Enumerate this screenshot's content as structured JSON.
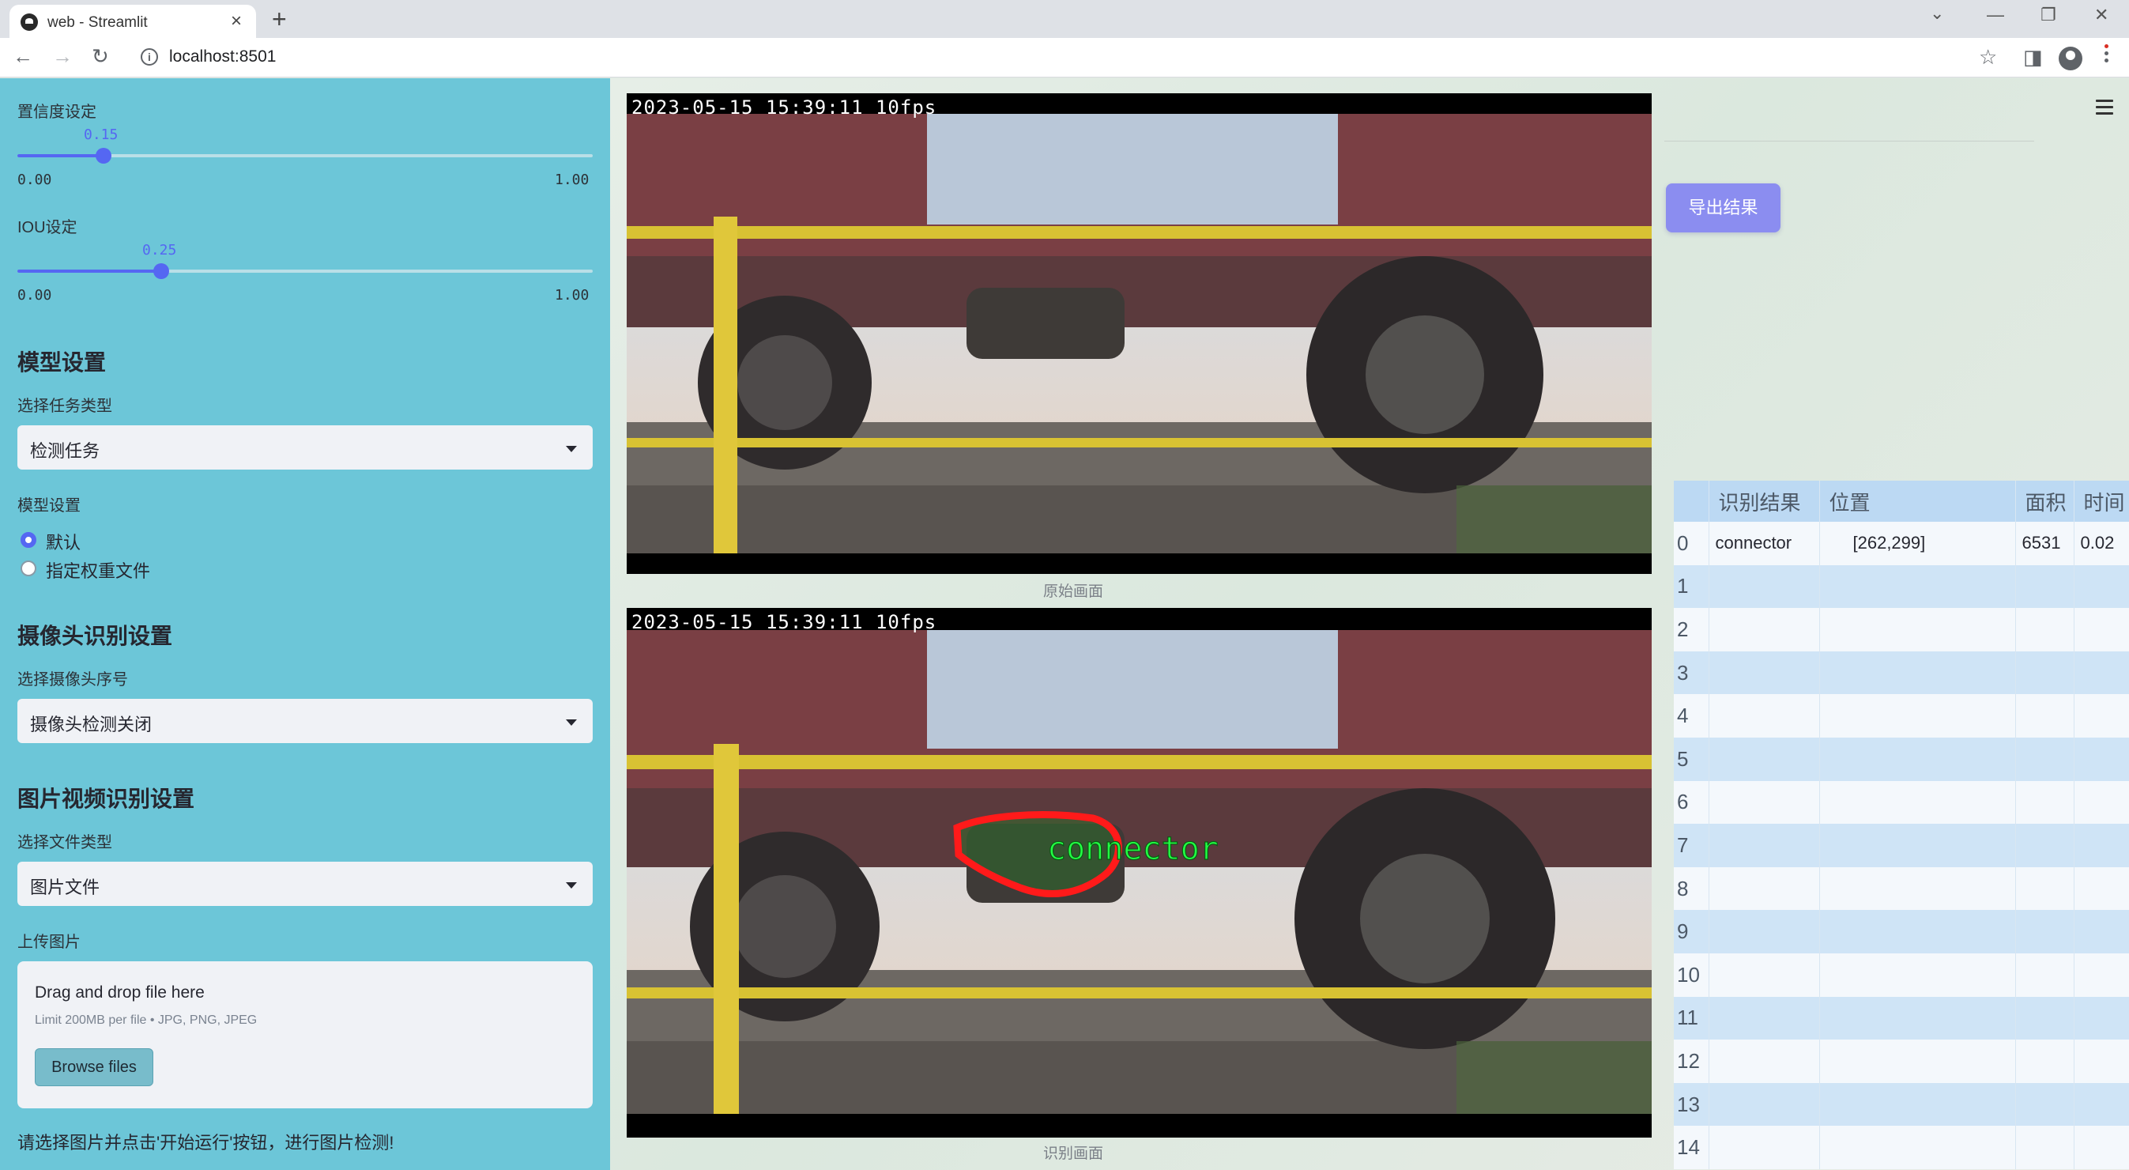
{
  "browser": {
    "tab_title": "web - Streamlit",
    "tab_close": "×",
    "new_tab": "+",
    "url": "localhost:8501",
    "nav_back": "←",
    "nav_forward": "→",
    "nav_reload": "↻",
    "window_minimize": "—",
    "window_restore": "❐",
    "window_close": "✕",
    "tab_list": "⌄",
    "bookmark_star": "☆",
    "side_panel": "◨"
  },
  "sidebar": {
    "confidence": {
      "label": "置信度设定",
      "value": "0.15",
      "value_fraction": 0.15,
      "min": "0.00",
      "max": "1.00"
    },
    "iou": {
      "label": "IOU设定",
      "value": "0.25",
      "value_fraction": 0.25,
      "min": "0.00",
      "max": "1.00"
    },
    "model_section": {
      "heading": "模型设置",
      "task_label": "选择任务类型",
      "task_value": "检测任务",
      "model_label": "模型设置",
      "radio_default": "默认",
      "radio_custom": "指定权重文件"
    },
    "camera_section": {
      "heading": "摄像头识别设置",
      "camera_label": "选择摄像头序号",
      "camera_value": "摄像头检测关闭"
    },
    "media_section": {
      "heading": "图片视频识别设置",
      "file_type_label": "选择文件类型",
      "file_type_value": "图片文件",
      "upload_label": "上传图片",
      "drop_text": "Drag and drop file here",
      "limit_text": "Limit 200MB per file • JPG, PNG, JPEG",
      "browse_label": "Browse files"
    },
    "hint": "请选择图片并点击'开始运行'按钮，进行图片检测!"
  },
  "main": {
    "original": {
      "timestamp": "2023-05-15 15:39:11 10fps",
      "caption": "原始画面"
    },
    "detected": {
      "timestamp": "2023-05-15 15:39:11 10fps",
      "caption": "识别画面",
      "detection_label": "connector"
    },
    "export_label": "导出结果",
    "table": {
      "headers": [
        "",
        "识别结果",
        "位置",
        "面积",
        "时间"
      ],
      "rows": [
        {
          "idx": "0",
          "result": "connector",
          "position": "[262,299]",
          "area": "6531",
          "time": "0.02"
        },
        {
          "idx": "1",
          "result": "",
          "position": "",
          "area": "",
          "time": ""
        },
        {
          "idx": "2",
          "result": "",
          "position": "",
          "area": "",
          "time": ""
        },
        {
          "idx": "3",
          "result": "",
          "position": "",
          "area": "",
          "time": ""
        },
        {
          "idx": "4",
          "result": "",
          "position": "",
          "area": "",
          "time": ""
        },
        {
          "idx": "5",
          "result": "",
          "position": "",
          "area": "",
          "time": ""
        },
        {
          "idx": "6",
          "result": "",
          "position": "",
          "area": "",
          "time": ""
        },
        {
          "idx": "7",
          "result": "",
          "position": "",
          "area": "",
          "time": ""
        },
        {
          "idx": "8",
          "result": "",
          "position": "",
          "area": "",
          "time": ""
        },
        {
          "idx": "9",
          "result": "",
          "position": "",
          "area": "",
          "time": ""
        },
        {
          "idx": "10",
          "result": "",
          "position": "",
          "area": "",
          "time": ""
        },
        {
          "idx": "11",
          "result": "",
          "position": "",
          "area": "",
          "time": ""
        },
        {
          "idx": "12",
          "result": "",
          "position": "",
          "area": "",
          "time": ""
        },
        {
          "idx": "13",
          "result": "",
          "position": "",
          "area": "",
          "time": ""
        },
        {
          "idx": "14",
          "result": "",
          "position": "",
          "area": "",
          "time": ""
        }
      ]
    }
  },
  "colors": {
    "sidebar_bg": "#6cc6d8",
    "accent": "#5567f2",
    "export_button": "#8b8df0",
    "table_header": "#bcd9f3",
    "table_row_alt": "#cfe4f6",
    "detection_outline": "#ff1a1a",
    "detection_text": "#22ff44"
  },
  "icons": [
    "streamlit-favicon",
    "info-icon",
    "star-icon",
    "side-panel-icon",
    "profile-icon",
    "kebab-menu-icon",
    "hamburger-menu-icon",
    "select-caret-icon"
  ]
}
